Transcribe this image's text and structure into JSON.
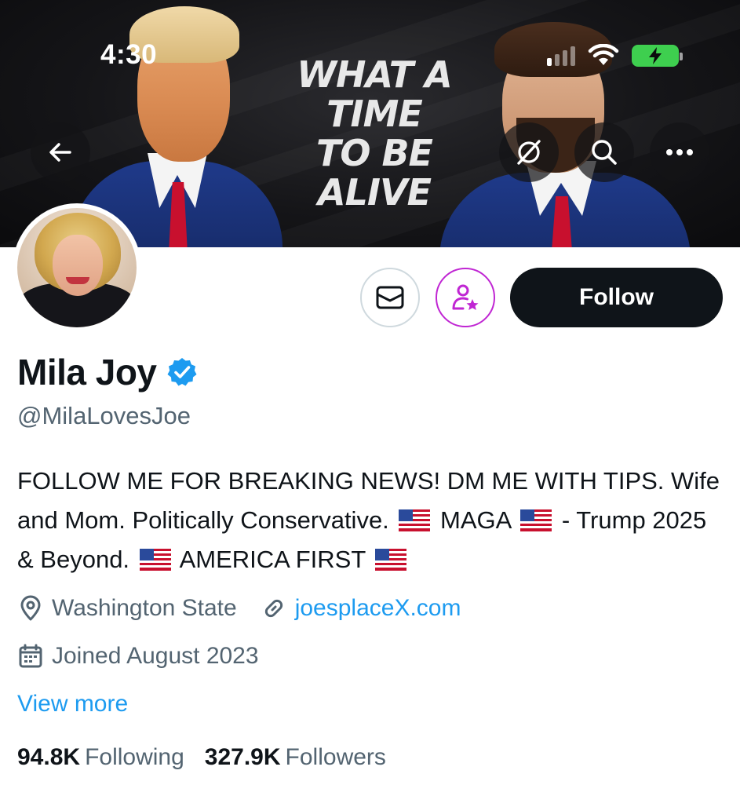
{
  "status_bar": {
    "time": "4:30"
  },
  "banner": {
    "lines": [
      "WHAT A",
      "TIME",
      "TO BE",
      "ALIVE"
    ]
  },
  "header_buttons": {
    "back_icon": "arrow-left-icon",
    "grok_icon": "grok-icon",
    "search_icon": "search-icon",
    "more_icon": "more-horizontal-icon"
  },
  "actions": {
    "message_icon": "mail-icon",
    "subscribe_icon": "person-star-icon",
    "follow_label": "Follow"
  },
  "profile": {
    "name": "Mila Joy",
    "verified": true,
    "handle": "@MilaLovesJoe",
    "bio_parts": [
      "FOLLOW ME FOR BREAKING NEWS! DM ME WITH TIPS. Wife and Mom. Politically Conservative.",
      "MAGA",
      "- Trump 2025 & Beyond.",
      "AMERICA FIRST"
    ],
    "location": "Washington State",
    "website": "joesplaceX.com",
    "joined": "Joined August 2023",
    "view_more": "View more"
  },
  "stats": {
    "following_count": "94.8K",
    "following_label": "Following",
    "followers_count": "327.9K",
    "followers_label": "Followers"
  },
  "colors": {
    "accent": "#1d9bf0",
    "text_primary": "#0f1419",
    "text_secondary": "#536471",
    "subscribe_purple": "#c026d3",
    "follow_bg": "#0f1419"
  }
}
